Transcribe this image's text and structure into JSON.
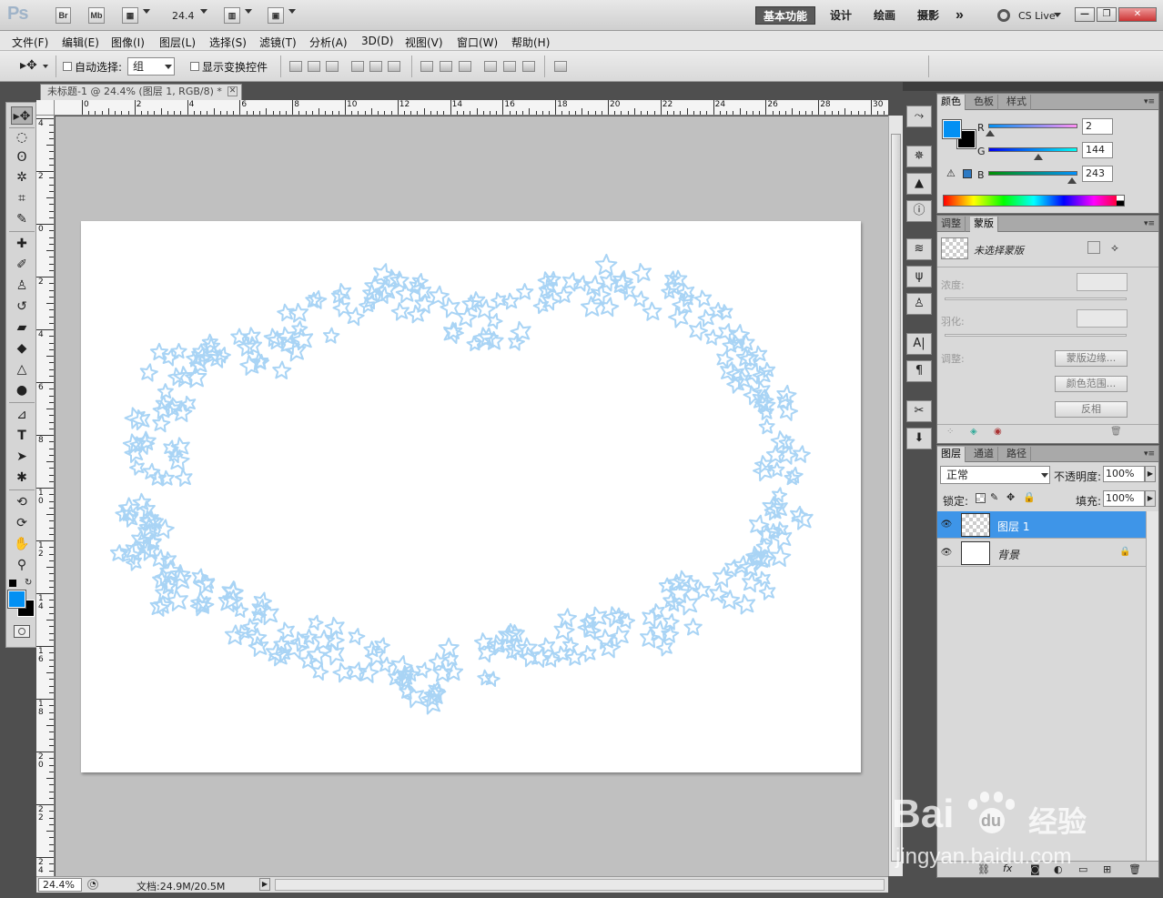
{
  "app": {
    "logo": "Ps",
    "bridge": "Br",
    "mini_bridge": "Mb",
    "zoom": "24.4",
    "workspaces": [
      "基本功能",
      "设计",
      "绘画",
      "摄影"
    ],
    "overflow": "»",
    "cs_live": "CS Live",
    "window_buttons": [
      "—",
      "❐",
      "✕"
    ]
  },
  "menu": [
    "文件(F)",
    "编辑(E)",
    "图像(I)",
    "图层(L)",
    "选择(S)",
    "滤镜(T)",
    "分析(A)",
    "3D(D)",
    "视图(V)",
    "窗口(W)",
    "帮助(H)"
  ],
  "options": {
    "auto_select_label": "自动选择:",
    "auto_select_value": "组",
    "show_transform_label": "显示变换控件"
  },
  "document": {
    "tab_title": "未标题-1 @ 24.4% (图层 1, RGB/8) *",
    "close": "✕",
    "h_ruler_labels": [
      "0",
      "2",
      "4",
      "6",
      "8",
      "10",
      "12",
      "14",
      "16",
      "18",
      "20",
      "22",
      "24",
      "26",
      "28",
      "30"
    ],
    "v_ruler_labels": [
      "4",
      "2",
      "0",
      "2",
      "4",
      "6",
      "8",
      "1 0",
      "1 2",
      "1 4",
      "1 6",
      "1 8",
      "2 0",
      "2 2",
      "2 4"
    ],
    "zoom_status": "24.4%",
    "doc_size": "文档:24.9M/20.5M",
    "star_color": "#a9d4f5"
  },
  "color_panel": {
    "tabs": [
      "颜色",
      "色板",
      "样式"
    ],
    "r_label": "R",
    "g_label": "G",
    "b_label": "B",
    "r": "2",
    "g": "144",
    "b": "243",
    "foreground": "#0290f3",
    "background": "#000000"
  },
  "masks_panel": {
    "tabs": [
      "调整",
      "蒙版"
    ],
    "no_mask": "未选择蒙版",
    "density": "浓度:",
    "feather": "羽化:",
    "refine": "调整:",
    "btn_edge": "蒙版边缘...",
    "btn_range": "颜色范围...",
    "btn_invert": "反相"
  },
  "layers_panel": {
    "tabs": [
      "图层",
      "通道",
      "路径"
    ],
    "blend_mode": "正常",
    "opacity_label": "不透明度:",
    "opacity": "100%",
    "lock_label": "锁定:",
    "fill_label": "填充:",
    "fill": "100%",
    "layers": [
      {
        "name": "图层 1",
        "selected": true
      },
      {
        "name": "背景",
        "selected": false
      }
    ]
  },
  "watermark": {
    "brand": "Bai",
    "paw": "du",
    "cn": "经验",
    "url": "jingyan.baidu.com"
  }
}
